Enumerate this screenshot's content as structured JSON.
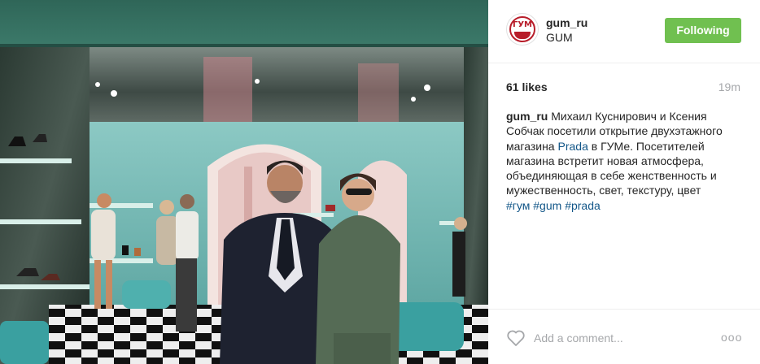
{
  "post": {
    "photo_alt": "",
    "colors": {
      "accent_link": "#125688",
      "follow_green": "#70c050",
      "brand_red": "#b81d2a"
    }
  },
  "header": {
    "avatar_icon": "gum-logo-icon",
    "avatar_logo_text": "ГУМ",
    "username": "gum_ru",
    "fullname": "GUM",
    "follow_label": "Following"
  },
  "meta": {
    "likes": "61 likes",
    "time": "19m"
  },
  "caption": {
    "username": "gum_ru",
    "text_1": "Михаил Куснирович и Ксения Собчак посетили открытие двухэтажного магазина ",
    "mention": "Prada",
    "text_2": " в ГУМе. Посетителей магазина встретит новая атмосфера, объединяющая в себе женственность и мужественность, свет, текстуру, цвет",
    "hashtags": [
      "#гум",
      "#gum",
      "#prada"
    ]
  },
  "footer": {
    "heart_icon": "heart-icon",
    "comment_placeholder": "Add a comment...",
    "more_icon": "more-options-icon",
    "more_label": "ooo"
  }
}
